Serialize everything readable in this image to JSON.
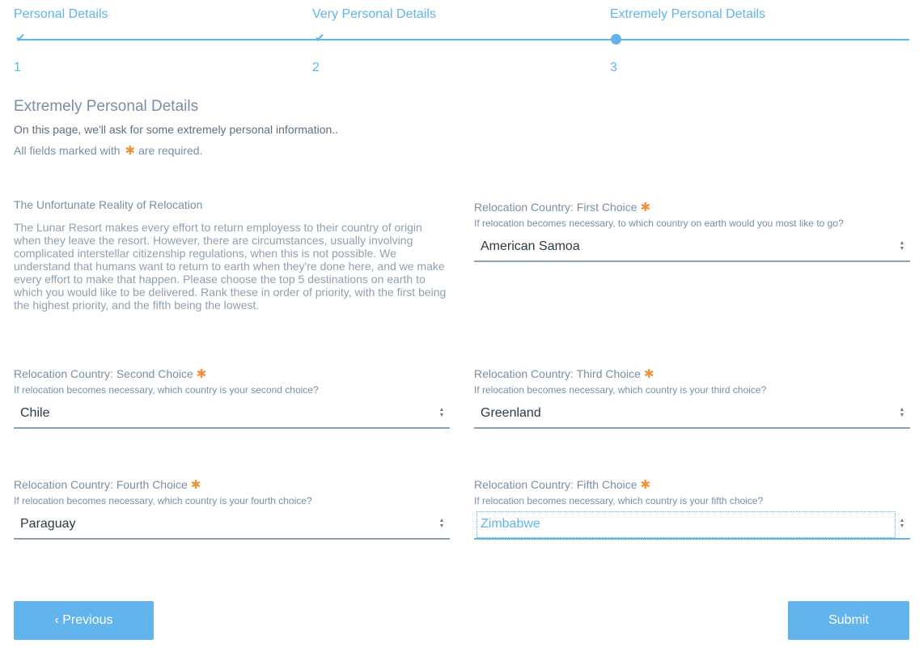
{
  "steps": [
    {
      "title": "Personal Details",
      "number": "1",
      "state": "complete"
    },
    {
      "title": "Very Personal Details",
      "number": "2",
      "state": "complete"
    },
    {
      "title": "Extremely Personal Details",
      "number": "3",
      "state": "current"
    }
  ],
  "page": {
    "heading": "Extremely Personal Details",
    "intro": "On this page, we'll ask for some extremely personal information..",
    "required_prefix": "All fields marked with",
    "required_suffix": "are required."
  },
  "info": {
    "title": "The Unfortunate Reality of Relocation",
    "body": "The Lunar Resort makes every effort to return employess to their country of origin when they leave the resort. However, there are circumstances, usually involving complicated interstellar citizenship regulations, when this is not possible. We understand that humans want to return to earth when they're done here, and we make every effort to make that happen. Please choose the top 5 destinations on earth to which you would like to be delivered. Rank these in order of priority, with the first being the highest priority, and the fifth being the lowest."
  },
  "fields": {
    "first": {
      "label": "Relocation Country: First Choice",
      "help": "If relocation becomes necessary, to which country on earth would you most like to go?",
      "value": "American Samoa"
    },
    "second": {
      "label": "Relocation Country: Second Choice",
      "help": "If relocation becomes necessary, which country is your second choice?",
      "value": "Chile"
    },
    "third": {
      "label": "Relocation Country: Third Choice",
      "help": "If relocation becomes necessary, which country is your third choice?",
      "value": "Greenland"
    },
    "fourth": {
      "label": "Relocation Country: Fourth Choice",
      "help": "If relocation becomes necessary, which country is your fourth choice?",
      "value": "Paraguay"
    },
    "fifth": {
      "label": "Relocation Country: Fifth Choice",
      "help": "If relocation becomes necessary, which country is your fifth choice?",
      "value": "Zimbabwe"
    }
  },
  "buttons": {
    "previous": "‹ Previous",
    "submit": "Submit"
  },
  "colors": {
    "accent": "#62b4ec",
    "required": "#f0913a",
    "text": "#7a8fa3"
  }
}
